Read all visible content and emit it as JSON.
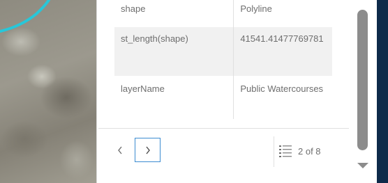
{
  "attributes": [
    {
      "key": "shape",
      "value": "Polyline"
    },
    {
      "key": "st_length(shape)",
      "value": "41541.41477769781"
    },
    {
      "key": "layerName",
      "value": "Public Watercourses"
    }
  ],
  "pager": {
    "prev_icon": "chevron-left-icon",
    "next_icon": "chevron-right-icon",
    "list_icon": "list-icon",
    "count_label": "2 of 8"
  },
  "colors": {
    "water_line": "#27c7d9",
    "focus_border": "#3b8bd1",
    "panel_text": "#6e6e6e",
    "right_strip": "#0e2a4a",
    "scrollbar_thumb": "#8c8c8c"
  }
}
